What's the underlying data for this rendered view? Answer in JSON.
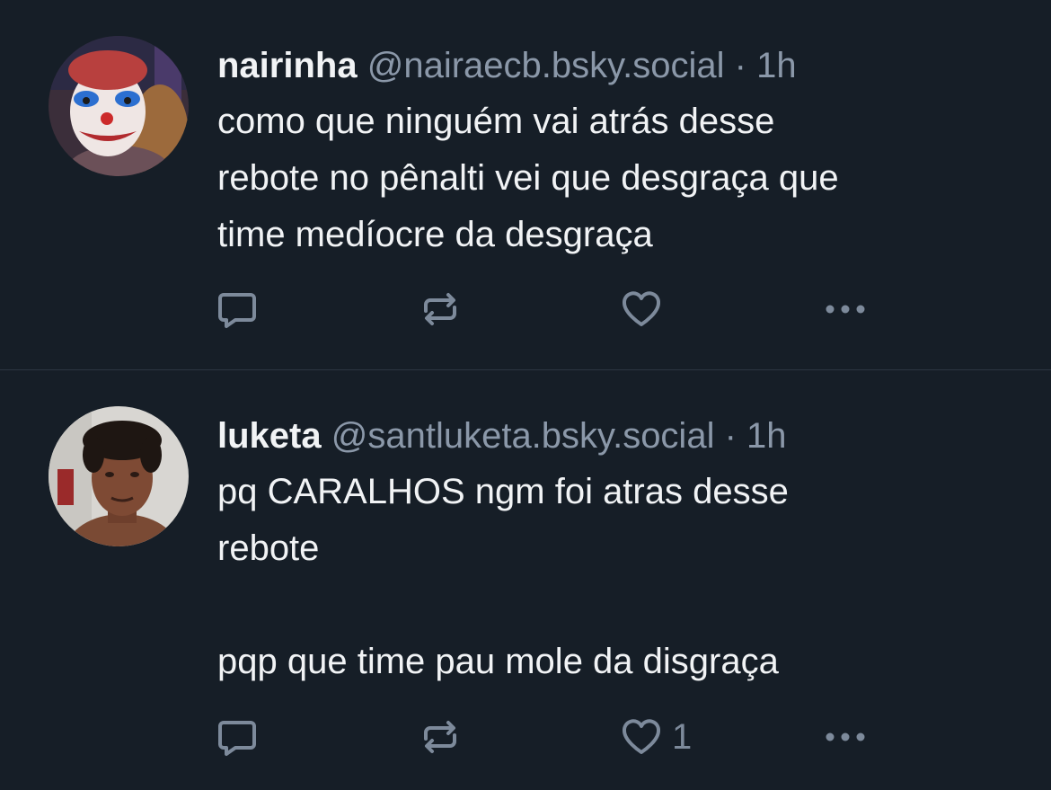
{
  "posts": [
    {
      "author": {
        "display_name": "nairinha",
        "handle": "@nairaecb.bsky.social"
      },
      "separator": "·",
      "time": "1h",
      "lines": [
        "como que ninguém vai atrás desse",
        "rebote no pênalti vei que desgraça que",
        "time medíocre da desgraça"
      ],
      "like_count": ""
    },
    {
      "author": {
        "display_name": "luketa",
        "handle": "@santluketa.bsky.social"
      },
      "separator": "·",
      "time": "1h",
      "lines": [
        "pq CARALHOS ngm foi atras desse",
        "rebote",
        "pqp que time pau mole da disgraça"
      ],
      "like_count": "1"
    }
  ],
  "icons": {
    "reply": "reply-icon",
    "repost": "repost-icon",
    "like": "heart-icon",
    "more": "more-icon"
  },
  "colors": {
    "background": "#161e27",
    "text": "#f1f3f5",
    "muted": "#8b98a9",
    "divider": "#2c3642"
  }
}
